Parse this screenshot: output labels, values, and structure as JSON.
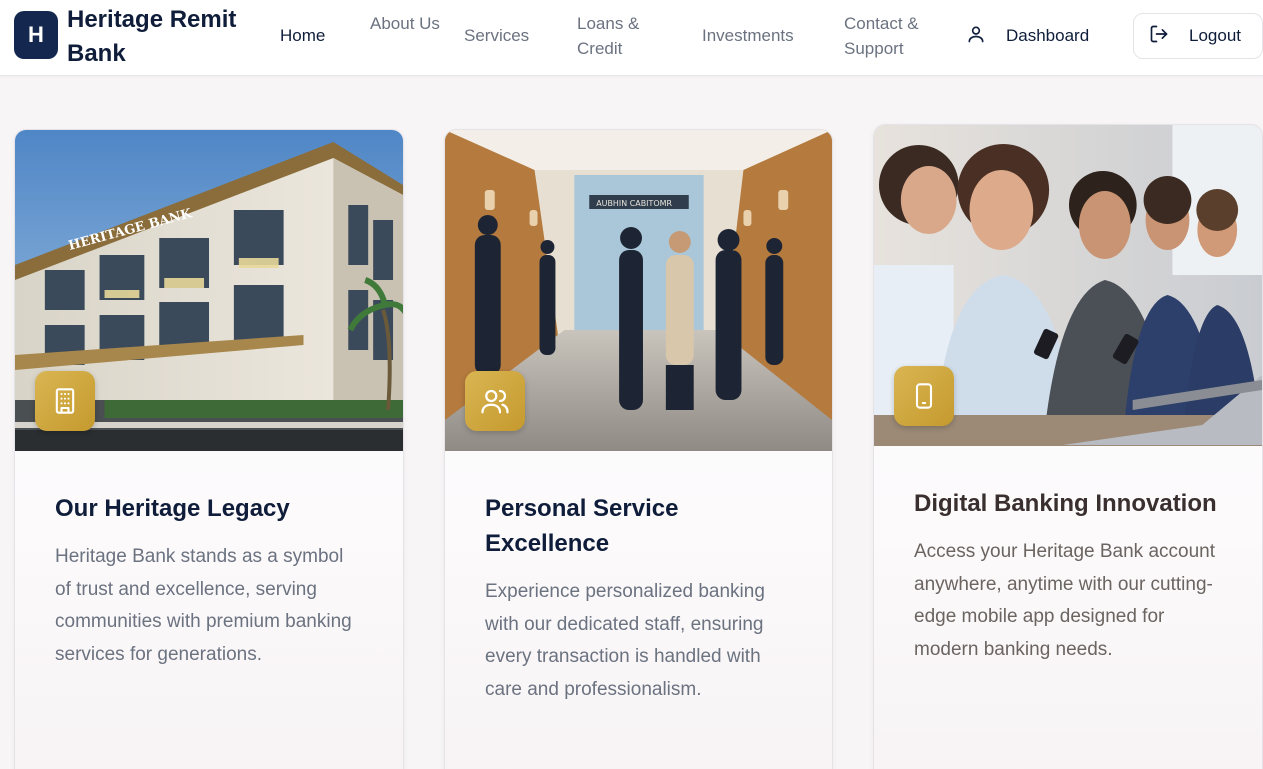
{
  "brand": {
    "logo_letter": "H",
    "name": "Heritage Remit Bank"
  },
  "nav": {
    "home": "Home",
    "about": "About Us",
    "services": "Services",
    "loans": "Loans & Credit",
    "investments": "Investments",
    "contact": "Contact & Support",
    "dashboard": "Dashboard",
    "logout": "Logout"
  },
  "colors": {
    "navy": "#14284f",
    "gold": "#c9a23a",
    "muted_text": "#6b7280"
  },
  "cards": [
    {
      "title": "Our Heritage Legacy",
      "text": "Heritage Bank stands as a symbol of trust and excellence, serving communities with premium banking services for generations.",
      "icon": "building-icon",
      "image_sign": "HERITAGE BANK"
    },
    {
      "title": "Personal Service Excellence",
      "text": "Experience personalized banking with our dedicated staff, ensuring every transaction is handled with care and professionalism.",
      "icon": "users-icon",
      "image_sign": "AUBHIN CABITOMR"
    },
    {
      "title": "Digital Banking Innovation",
      "text": "Access your Heritage Bank account anywhere, anytime with our cutting-edge mobile app designed for modern banking needs.",
      "icon": "smartphone-icon"
    }
  ]
}
